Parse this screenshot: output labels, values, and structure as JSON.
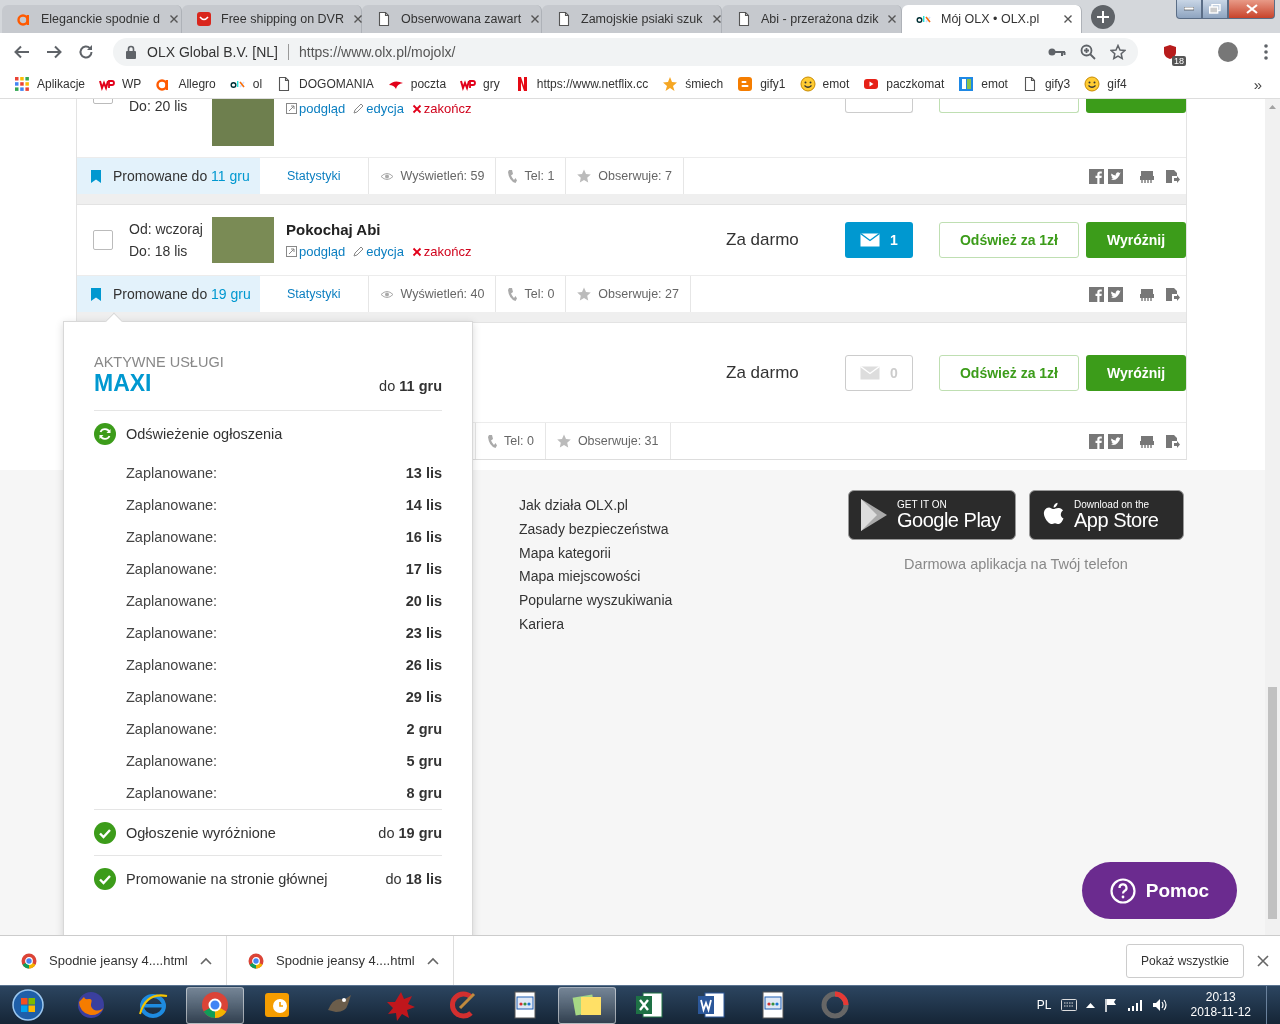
{
  "browser": {
    "tabs": [
      {
        "title": "Eleganckie spodnie d",
        "kind": "letter-a",
        "selected": false
      },
      {
        "title": "Free shipping on DVR",
        "kind": "bag",
        "selected": false
      },
      {
        "title": "Obserwowana zawart",
        "kind": "page",
        "selected": false
      },
      {
        "title": "Zamojskie psiaki szuk",
        "kind": "page",
        "selected": false
      },
      {
        "title": "Abi - przerażona dzik",
        "kind": "page",
        "selected": false
      },
      {
        "title": "Mój OLX • OLX.pl",
        "kind": "olx",
        "selected": true
      }
    ],
    "address": {
      "site_name": "OLX Global B.V. [NL]",
      "url": "https://www.olx.pl/mojolx/"
    },
    "extension_badge": "18",
    "bookmarks": [
      {
        "label": "Aplikacje",
        "kind": "grid"
      },
      {
        "label": "WP",
        "kind": "wp"
      },
      {
        "label": "Allegro",
        "kind": "letter-a"
      },
      {
        "label": "ol",
        "kind": "olx"
      },
      {
        "label": "DOGOMANIA",
        "kind": "page"
      },
      {
        "label": "poczta",
        "kind": "bird"
      },
      {
        "label": "gry",
        "kind": "wp"
      },
      {
        "label": "https://www.netflix.cc",
        "kind": "n"
      },
      {
        "label": "śmiech",
        "kind": "star"
      },
      {
        "label": "gify1",
        "kind": "blogger"
      },
      {
        "label": "emot",
        "kind": "smiley"
      },
      {
        "label": "paczkomat",
        "kind": "play"
      },
      {
        "label": "emot",
        "kind": "b"
      },
      {
        "label": "gify3",
        "kind": "page"
      },
      {
        "label": "gif4",
        "kind": "smiley"
      }
    ],
    "bookmarks_more": "»"
  },
  "listings": [
    {
      "kind": "partial",
      "checked": false,
      "to": "Do: 20 lis",
      "links": [
        {
          "label": "podgląd",
          "kind": "preview"
        },
        {
          "label": "edycja",
          "kind": "edit"
        },
        {
          "label": "zakończ",
          "kind": "end"
        }
      ],
      "promo": {
        "label": "Promowane do",
        "date": "11 gru"
      },
      "stats_link": "Statystyki",
      "views": "Wyświetleń: 59",
      "phone": "Tel: 1",
      "watchers": "Obserwuje: 7"
    },
    {
      "kind": "full",
      "checked": false,
      "from": "Od: wczoraj",
      "to": "Do: 18 lis",
      "title": "Pokochaj Abi",
      "links": [
        {
          "label": "podgląd",
          "kind": "preview"
        },
        {
          "label": "edycja",
          "kind": "edit"
        },
        {
          "label": "zakończ",
          "kind": "end"
        }
      ],
      "price": "Za darmo",
      "messages": {
        "count": "1",
        "disabled": false
      },
      "refresh": "Odśwież za 1zł",
      "highlight": "Wyróżnij",
      "promo": {
        "label": "Promowane do",
        "date": "19 gru"
      },
      "stats_link": "Statystyki",
      "views": "Wyświetleń: 40",
      "phone": "Tel: 0",
      "watchers": "Obserwuje: 27"
    },
    {
      "kind": "covered",
      "price": "Za darmo",
      "messages": {
        "count": "0",
        "disabled": true
      },
      "refresh": "Odśwież za 1zł",
      "highlight": "Wyróżnij",
      "phone": "Tel: 0",
      "watchers": "Obserwuje: 31"
    }
  ],
  "popup": {
    "heading": "AKTYWNE USŁUGI",
    "package": "MAXI",
    "package_until": "do **11 gru**",
    "services": [
      {
        "kind": "refresh",
        "name": "Odświeżenie ogłoszenia",
        "schedule": [
          {
            "label": "Zaplanowane:",
            "date": "13 lis"
          },
          {
            "label": "Zaplanowane:",
            "date": "14 lis"
          },
          {
            "label": "Zaplanowane:",
            "date": "16 lis"
          },
          {
            "label": "Zaplanowane:",
            "date": "17 lis"
          },
          {
            "label": "Zaplanowane:",
            "date": "20 lis"
          },
          {
            "label": "Zaplanowane:",
            "date": "23 lis"
          },
          {
            "label": "Zaplanowane:",
            "date": "26 lis"
          },
          {
            "label": "Zaplanowane:",
            "date": "29 lis"
          },
          {
            "label": "Zaplanowane:",
            "date": "2 gru"
          },
          {
            "label": "Zaplanowane:",
            "date": "5 gru"
          },
          {
            "label": "Zaplanowane:",
            "date": "8 gru"
          }
        ]
      },
      {
        "kind": "check",
        "name": "Ogłoszenie wyróżnione",
        "until": "do **19 gru**"
      },
      {
        "kind": "check",
        "name": "Promowanie na stronie głównej",
        "until": "do **18 lis**"
      }
    ]
  },
  "footer": {
    "links": [
      "Jak działa OLX.pl",
      "Zasady bezpieczeństwa",
      "Mapa kategorii",
      "Mapa miejscowości",
      "Popularne wyszukiwania",
      "Kariera"
    ],
    "badges": [
      {
        "kind": "play",
        "small": "GET IT ON",
        "big": "Google Play"
      },
      {
        "kind": "apple",
        "small": "Download on the",
        "big": "App Store"
      }
    ],
    "caption": "Darmowa aplikacja na Twój telefon"
  },
  "help_button": "Pomoc",
  "downloads": {
    "items": [
      {
        "name": "Spodnie jeansy 4....html"
      },
      {
        "name": "Spodnie jeansy 4....html"
      }
    ],
    "show_all": "Pokaż wszystkie"
  },
  "taskbar": {
    "items": [
      {
        "kind": "start",
        "active": false
      },
      {
        "kind": "fox",
        "active": false
      },
      {
        "kind": "e",
        "active": false
      },
      {
        "kind": "ring",
        "active": true
      },
      {
        "kind": "mail",
        "active": false
      },
      {
        "kind": "paint",
        "active": false
      },
      {
        "kind": "splat",
        "active": false
      },
      {
        "kind": "brush",
        "active": false
      },
      {
        "kind": "window",
        "active": false
      },
      {
        "kind": "notes",
        "active": true
      },
      {
        "kind": "sheet",
        "active": false
      },
      {
        "kind": "doc",
        "active": false
      },
      {
        "kind": "window",
        "active": false
      },
      {
        "kind": "disc",
        "active": false
      }
    ],
    "language": "PL",
    "time": "20:13",
    "date": "2018-11-12"
  }
}
